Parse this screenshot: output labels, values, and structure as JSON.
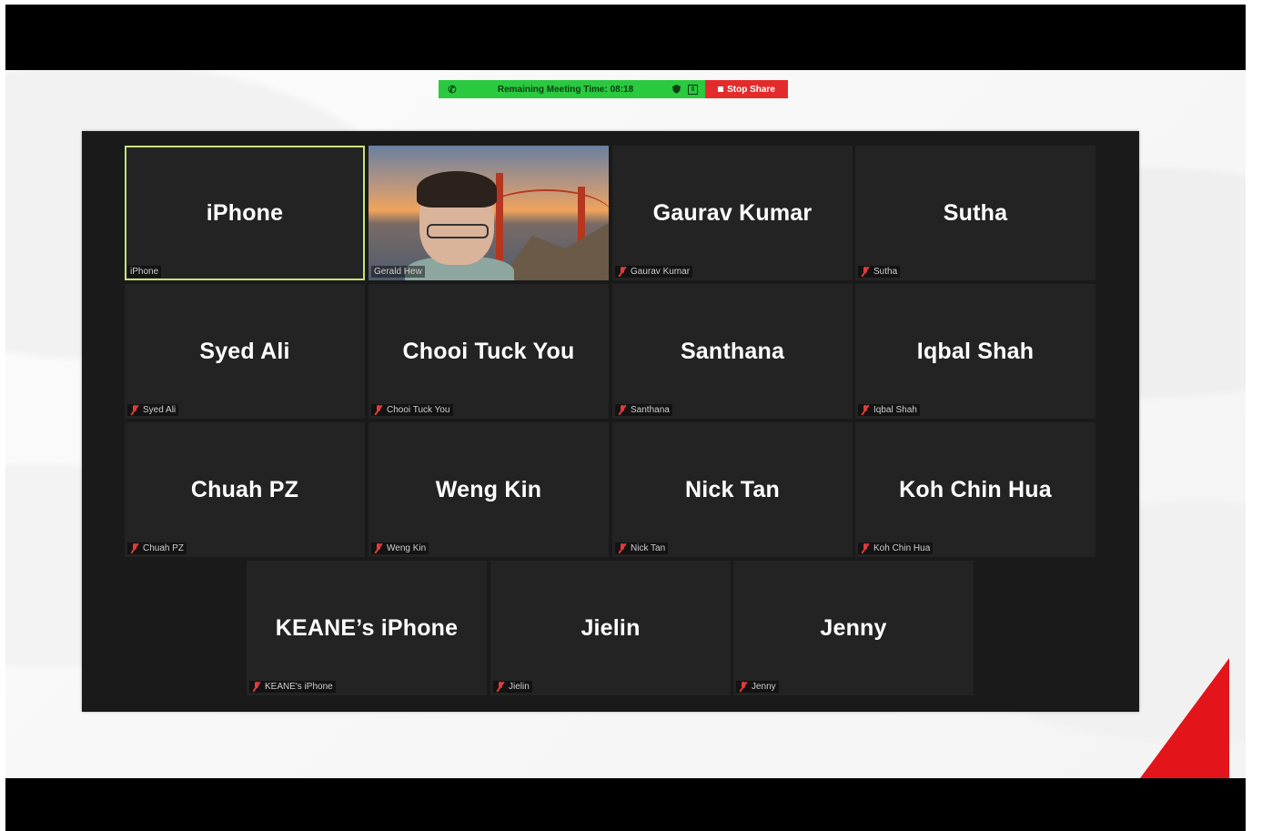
{
  "meeting_bar": {
    "timer_text": "Remaining Meeting Time: 08:18",
    "stop_share_label": "Stop Share",
    "phone_icon": "phone-icon",
    "shield_icon": "shield-icon",
    "pause_icon": "pause-icon",
    "green": "#2ac940",
    "red": "#e42b2b"
  },
  "participants": [
    {
      "name": "iPhone",
      "label": "iPhone",
      "muted": false,
      "active": true
    },
    {
      "name": "",
      "label": "Gerald Hew",
      "muted": false,
      "video": true
    },
    {
      "name": "Gaurav Kumar",
      "label": "Gaurav Kumar",
      "muted": true
    },
    {
      "name": "Sutha",
      "label": "Sutha",
      "muted": true
    },
    {
      "name": "Syed Ali",
      "label": "Syed Ali",
      "muted": true
    },
    {
      "name": "Chooi Tuck You",
      "label": "Chooi Tuck You",
      "muted": true
    },
    {
      "name": "Santhana",
      "label": "Santhana",
      "muted": true
    },
    {
      "name": "Iqbal Shah",
      "label": "Iqbal Shah",
      "muted": true
    },
    {
      "name": "Chuah PZ",
      "label": "Chuah PZ",
      "muted": true
    },
    {
      "name": "Weng Kin",
      "label": "Weng Kin",
      "muted": true
    },
    {
      "name": "Nick Tan",
      "label": "Nick Tan",
      "muted": true
    },
    {
      "name": "Koh Chin Hua",
      "label": "Koh Chin Hua",
      "muted": true
    },
    {
      "name": "KEANE’s iPhone",
      "label": "KEANE's iPhone",
      "muted": true
    },
    {
      "name": "Jielin",
      "label": "Jielin",
      "muted": true
    },
    {
      "name": "Jenny",
      "label": "Jenny",
      "muted": true
    }
  ],
  "colors": {
    "tile_bg": "#232323",
    "gallery_bg": "#1a1a1a",
    "active_speaker_outline": "#c9e17a",
    "muted_mic": "#e23b3b",
    "corner_accent": "#e3151b"
  }
}
